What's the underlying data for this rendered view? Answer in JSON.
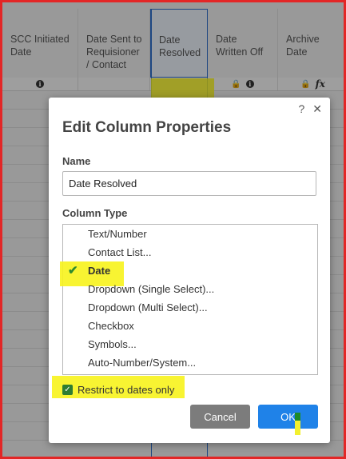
{
  "grid": {
    "columns": [
      {
        "label": "SCC Initiated Date"
      },
      {
        "label": "Date Sent to Requisioner / Contact"
      },
      {
        "label": "Date Resolved"
      },
      {
        "label": "Date Written Off"
      },
      {
        "label": "Archive Date"
      }
    ],
    "icons": {
      "info_glyph": "i",
      "lock_glyph": "🔒",
      "fx_glyph": "fx"
    }
  },
  "dialog": {
    "title": "Edit Column Properties",
    "help_glyph": "?",
    "close_glyph": "✕",
    "name_label": "Name",
    "name_value": "Date Resolved",
    "type_label": "Column Type",
    "types": [
      {
        "label": "Text/Number"
      },
      {
        "label": "Contact List..."
      },
      {
        "label": "Date",
        "selected": true
      },
      {
        "label": "Dropdown (Single Select)..."
      },
      {
        "label": "Dropdown (Multi Select)..."
      },
      {
        "label": "Checkbox"
      },
      {
        "label": "Symbols..."
      },
      {
        "label": "Auto-Number/System..."
      }
    ],
    "check_glyph": "✔",
    "restrict_label": "Restrict to dates only",
    "restrict_checked": true,
    "cancel_label": "Cancel",
    "ok_label": "OK"
  },
  "colors": {
    "highlight": "#f7f31c",
    "ok_button": "#1f82e8",
    "cancel_button": "#7c7c7c",
    "check_green": "#2e8b2e",
    "frame_border": "#e32626"
  }
}
